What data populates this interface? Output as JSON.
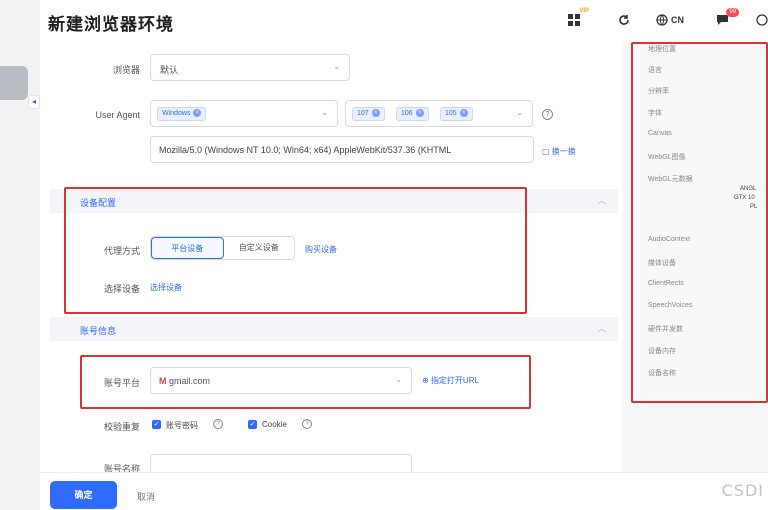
{
  "header": {
    "title": "新建浏览器环境",
    "vip_badge": "VIP",
    "lang": "CN",
    "notify_count": "99"
  },
  "form": {
    "browser": {
      "label": "浏览器",
      "value": "默认"
    },
    "user_agent": {
      "label": "User Agent",
      "os_tag": "Windows",
      "version_tags": [
        "107",
        "106",
        "105"
      ],
      "value": "Mozilla/5.0 (Windows NT 10.0; Win64; x64) AppleWebKit/537.36 (KHTML",
      "change_label": "换一换"
    },
    "device_section": {
      "title": "设备配置",
      "proxy_label": "代理方式",
      "options": [
        "平台设备",
        "自定义设备"
      ],
      "buy_link": "购买设备",
      "select_label": "选择设备",
      "select_link": "选择设备"
    },
    "account_section": {
      "title": "账号信息",
      "platform_label": "账号平台",
      "platform_value": "gmail.com",
      "open_url_label": "指定打开URL",
      "verify_label": "校验重复",
      "check_password": "账号密码",
      "check_cookie": "Cookie",
      "next_label": "账号名称"
    }
  },
  "right_panel": {
    "items": [
      "地理位置",
      "语言",
      "分辨率",
      "字体",
      "Canvas",
      "WebGL图像",
      "WebGL元数据",
      "AudioContext",
      "媒体设备",
      "ClientRects",
      "SpeechVoices",
      "硬件并发数",
      "设备内存",
      "设备名称"
    ],
    "webgl_value": [
      "ANGL",
      "GTX 10",
      "PL"
    ]
  },
  "footer": {
    "confirm": "确定",
    "cancel": "取消",
    "watermark": "CSDI"
  }
}
